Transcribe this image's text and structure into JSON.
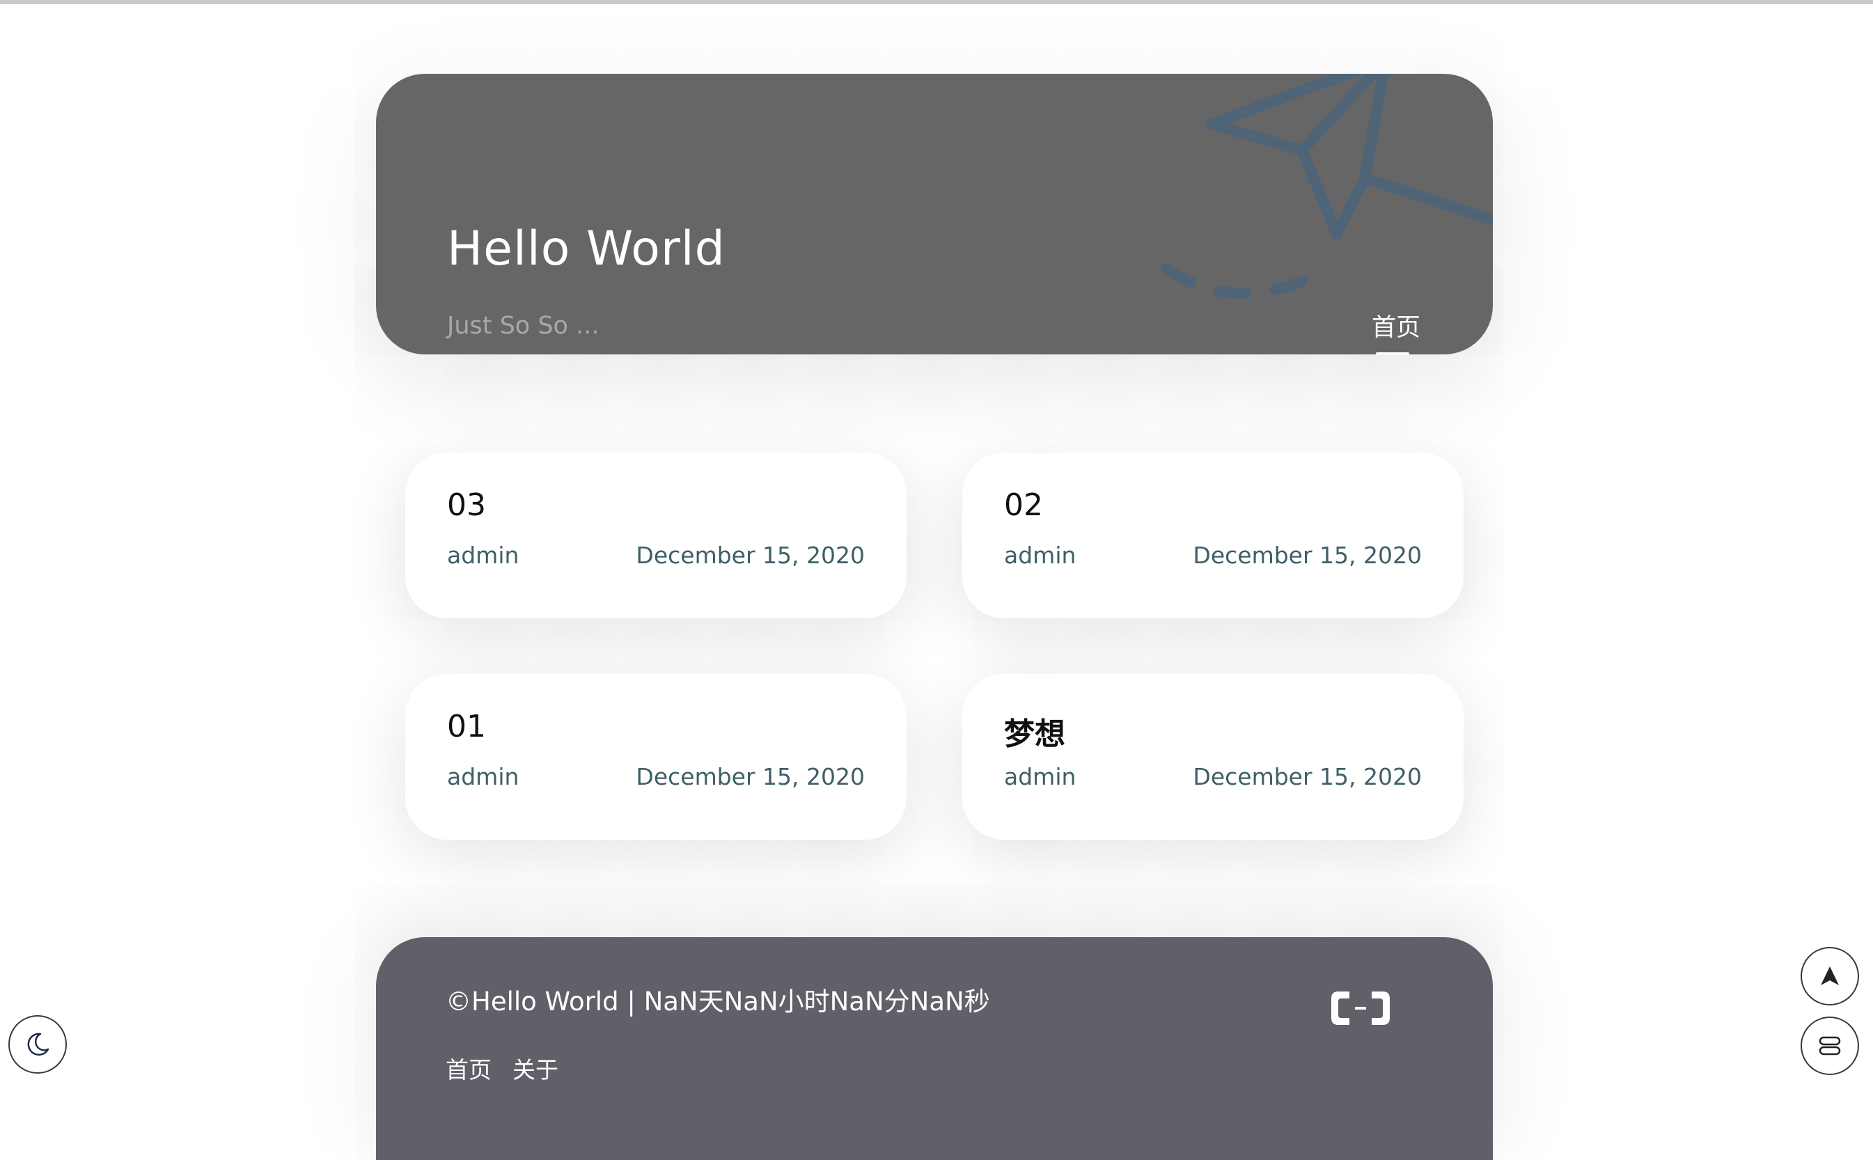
{
  "header": {
    "title": "Hello World",
    "subtitle": "Just So So ...",
    "nav_home": "首页"
  },
  "posts": [
    {
      "title": "03",
      "author": "admin",
      "date": "December 15, 2020"
    },
    {
      "title": "02",
      "author": "admin",
      "date": "December 15, 2020"
    },
    {
      "title": "01",
      "author": "admin",
      "date": "December 15, 2020"
    },
    {
      "title": "梦想",
      "author": "admin",
      "date": "December 15, 2020"
    }
  ],
  "footer": {
    "copyright": "©Hello World | NaN天NaN小时NaN分NaN秒",
    "links": [
      "首页",
      "关于"
    ]
  },
  "icons": {
    "dark_mode": "moon-icon",
    "back_to_top": "arrow-up-icon",
    "toc": "menu-icon",
    "logo": "cloud-logo-icon",
    "decoration": "paper-plane-icon"
  },
  "colors": {
    "header_bg": "#666666",
    "footer_bg": "#5f6068",
    "meta_text": "#3f5f67",
    "plane_accent": "#4e6479"
  }
}
